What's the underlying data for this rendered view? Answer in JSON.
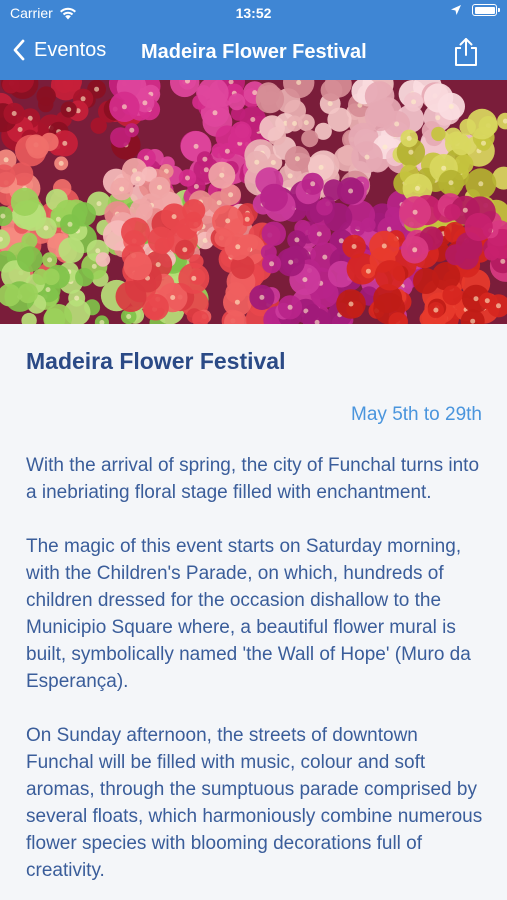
{
  "status_bar": {
    "carrier": "Carrier",
    "time": "13:52",
    "battery_level": 1.0,
    "icons": [
      "wifi-icon",
      "location-arrow-icon",
      "battery-icon"
    ]
  },
  "nav": {
    "back_label": "Eventos",
    "title": "Madeira Flower Festival",
    "icons": [
      "chevron-left-icon",
      "share-icon"
    ]
  },
  "event": {
    "title": "Madeira Flower Festival",
    "dates": "May 5th to 29th",
    "paragraphs": [
      "With the arrival of spring, the city of Funchal turns into a inebriating floral stage filled with enchantment.",
      "The magic of this event starts on Saturday morning, with the Children's Parade, on which, hundreds of children dressed for the occasion dishallow to the Municipio Square where, a beautiful flower mural is built, symbolically named 'the Wall of Hope' (Muro da Esperança).",
      "On Sunday afternoon, the streets of downtown Funchal will be filled with music, colour and soft aromas, through the sumptuous parade comprised by several floats, which harmoniously combine numerous flower species with blooming decorations full of creativity."
    ]
  },
  "colors": {
    "header": "#3f86d4",
    "title_text": "#2b4a86",
    "date_text": "#4a95dd",
    "body_text": "#3a5d9a",
    "background": "#f4f6f9"
  }
}
